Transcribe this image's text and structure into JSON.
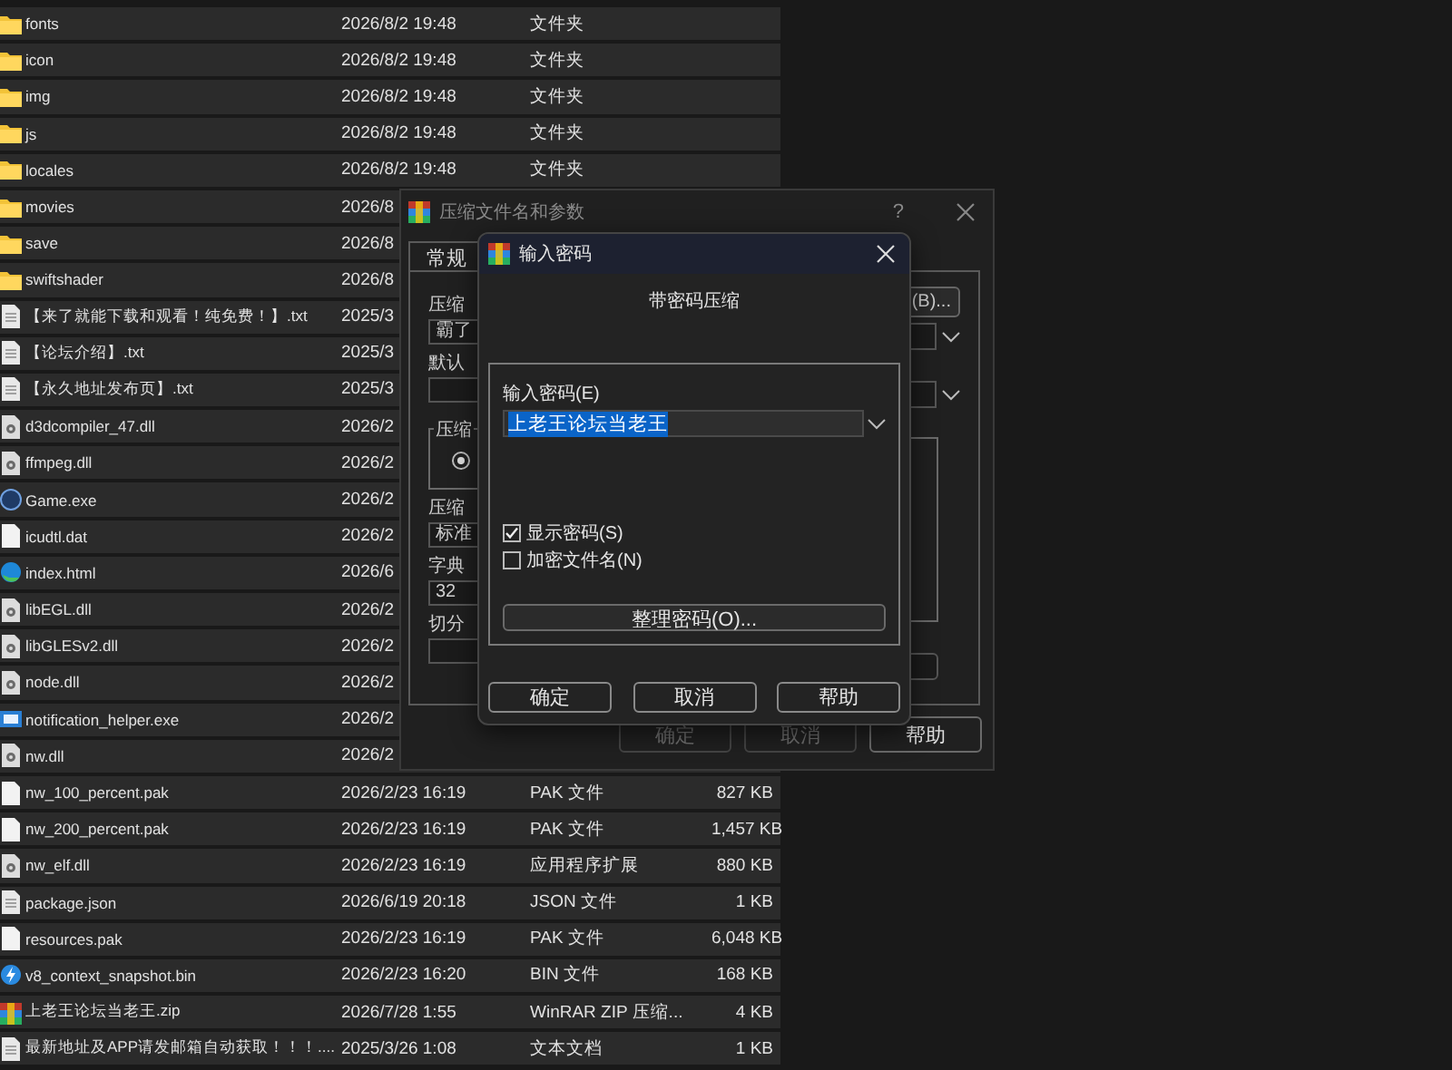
{
  "file_list": {
    "rows": [
      {
        "name": "fonts",
        "kind": "folder",
        "modified": "2026/8/2 19:48",
        "type": "文件夹"
      },
      {
        "name": "icon",
        "kind": "folder",
        "modified": "2026/8/2 19:48",
        "type": "文件夹"
      },
      {
        "name": "img",
        "kind": "folder",
        "modified": "2026/8/2 19:48",
        "type": "文件夹"
      },
      {
        "name": "js",
        "kind": "folder",
        "modified": "2026/8/2 19:48",
        "type": "文件夹"
      },
      {
        "name": "locales",
        "kind": "folder",
        "modified": "2026/8/2 19:48",
        "type": "文件夹"
      },
      {
        "name": "movies",
        "kind": "folder",
        "modified": "2026/8"
      },
      {
        "name": "save",
        "kind": "folder",
        "modified": "2026/8"
      },
      {
        "name": "swiftshader",
        "kind": "folder",
        "modified": "2026/8"
      },
      {
        "name": "【来了就能下载和观看！纯免费！】.txt",
        "kind": "text",
        "modified": "2025/3"
      },
      {
        "name": "【论坛介绍】.txt",
        "kind": "text",
        "modified": "2025/3"
      },
      {
        "name": "【永久地址发布页】.txt",
        "kind": "text",
        "modified": "2025/3"
      },
      {
        "name": "d3dcompiler_47.dll",
        "kind": "dll",
        "modified": "2026/2"
      },
      {
        "name": "ffmpeg.dll",
        "kind": "dll",
        "modified": "2026/2"
      },
      {
        "name": "Game.exe",
        "kind": "exe",
        "modified": "2026/2"
      },
      {
        "name": "icudtl.dat",
        "kind": "file",
        "modified": "2026/2"
      },
      {
        "name": "index.html",
        "kind": "html",
        "modified": "2026/6"
      },
      {
        "name": "libEGL.dll",
        "kind": "dll",
        "modified": "2026/2"
      },
      {
        "name": "libGLESv2.dll",
        "kind": "dll",
        "modified": "2026/2"
      },
      {
        "name": "node.dll",
        "kind": "dll",
        "modified": "2026/2"
      },
      {
        "name": "notification_helper.exe",
        "kind": "app",
        "modified": "2026/2"
      },
      {
        "name": "nw.dll",
        "kind": "dll",
        "modified": "2026/2"
      },
      {
        "name": "nw_100_percent.pak",
        "kind": "file",
        "modified": "2026/2/23 16:19",
        "type": "PAK 文件",
        "size": "827 KB"
      },
      {
        "name": "nw_200_percent.pak",
        "kind": "file",
        "modified": "2026/2/23 16:19",
        "type": "PAK 文件",
        "size": "1,457 KB"
      },
      {
        "name": "nw_elf.dll",
        "kind": "dll",
        "modified": "2026/2/23 16:19",
        "type": "应用程序扩展",
        "size": "880 KB"
      },
      {
        "name": "package.json",
        "kind": "text",
        "modified": "2026/6/19 20:18",
        "type": "JSON 文件",
        "size": "1 KB"
      },
      {
        "name": "resources.pak",
        "kind": "file",
        "modified": "2026/2/23 16:19",
        "type": "PAK 文件",
        "size": "6,048 KB"
      },
      {
        "name": "v8_context_snapshot.bin",
        "kind": "bin",
        "modified": "2026/2/23 16:20",
        "type": "BIN 文件",
        "size": "168 KB"
      },
      {
        "name": "上老王论坛当老王.zip",
        "kind": "zip",
        "modified": "2026/7/28 1:55",
        "type": "WinRAR ZIP 压缩...",
        "size": "4 KB"
      },
      {
        "name": "最新地址及APP请发邮箱自动获取！！！....",
        "kind": "text",
        "modified": "2025/3/26 1:08",
        "type": "文本文档",
        "size": "1 KB"
      }
    ]
  },
  "back_dialog": {
    "title": "压缩文件名和参数",
    "help": "?",
    "tabs": [
      {
        "label": "常规",
        "selected": true
      }
    ],
    "archive_name_label": "压缩",
    "archive_name": "霸了",
    "profile_label": "默认",
    "format_group": {
      "label": "压缩",
      "option_selected": true
    },
    "method_label": "压缩",
    "method": "标准",
    "dictionary_label": "字典",
    "dictionary": "32",
    "split_label": "切分",
    "browse_button": "(B)...",
    "buttons": [
      {
        "label": "确定",
        "disabled": true
      },
      {
        "label": "取消",
        "disabled": true
      },
      {
        "label": "帮助",
        "disabled": false
      }
    ]
  },
  "password_dialog": {
    "title": "输入密码",
    "heading": "带密码压缩",
    "password_label": "输入密码(E)",
    "password": "上老王论坛当老王",
    "password_selected": true,
    "options": [
      {
        "label": "显示密码(S)",
        "checked": true
      },
      {
        "label": "加密文件名(N)",
        "checked": false
      }
    ],
    "organize_button": "整理密码(O)...",
    "buttons": [
      "确定",
      "取消",
      "帮助"
    ]
  }
}
